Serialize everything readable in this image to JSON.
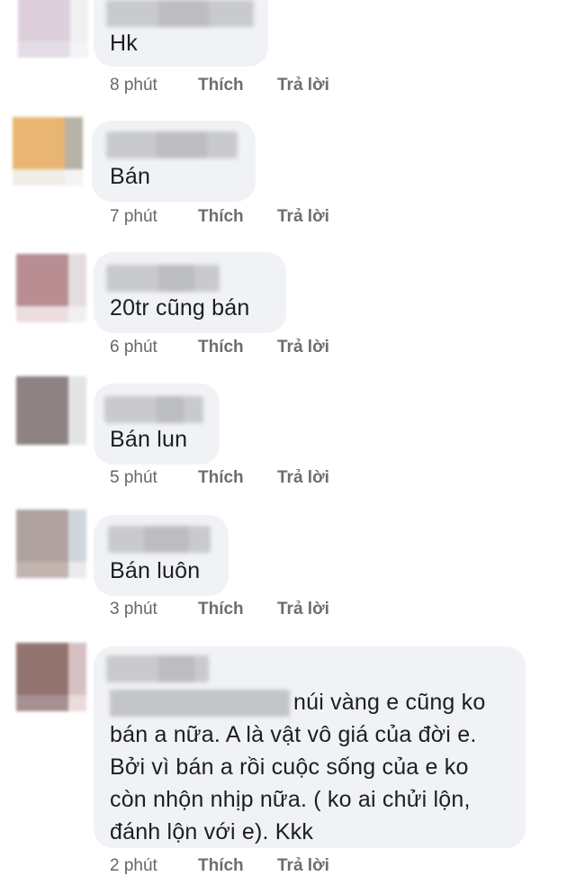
{
  "comments": [
    {
      "text": "Hk",
      "time": "8 phút",
      "like": "Thích",
      "reply": "Trả lời",
      "avatar": {
        "main": "#ddd0dc",
        "side": "#eef0f2",
        "bot": "#e4dce4",
        "corner": "#f4f4f6"
      }
    },
    {
      "text": "Bán",
      "time": "7 phút",
      "like": "Thích",
      "reply": "Trả lời",
      "avatar": {
        "main": "#e9b572",
        "side": "#b8b2a6",
        "bot": "#efede6",
        "corner": "#f4f4f4"
      }
    },
    {
      "text": "20tr cũng bán",
      "time": "6 phút",
      "like": "Thích",
      "reply": "Trả lời",
      "avatar": {
        "main": "#b88e93",
        "side": "#e4dde0",
        "bot": "#ecdde0",
        "corner": "#f2eff0"
      }
    },
    {
      "text": "Bán lun",
      "time": "5 phút",
      "like": "Thích",
      "reply": "Trả lời",
      "avatar": {
        "main": "#8e8283",
        "side": "#e2e4e6",
        "bot": "#9a8e90",
        "corner": "#eeeeee"
      }
    },
    {
      "text": "Bán luôn",
      "time": "3 phút",
      "like": "Thích",
      "reply": "Trả lời",
      "avatar": {
        "main": "#b0a29e",
        "side": "#cfd7dc",
        "bot": "#c2b5af",
        "corner": "#e8eaec"
      }
    },
    {
      "text_lines": [
        "núi vàng e cũng ko",
        "bán a nữa. A là vật vô giá của đời e.",
        "Bởi vì bán a rồi cuộc sống của e ko",
        "còn nhộn nhịp nữa. ( ko ai chửi lộn,",
        "đánh lộn với e). Kkk"
      ],
      "time": "2 phút",
      "like": "Thích",
      "reply": "Trả lời",
      "avatar": {
        "main": "#927470",
        "side": "#d7c0c2",
        "bot": "#a88f92",
        "corner": "#e8dcdc"
      }
    }
  ]
}
